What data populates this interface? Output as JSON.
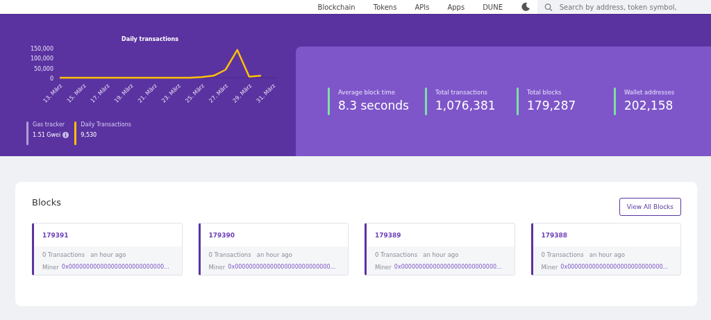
{
  "nav": {
    "items": [
      "Blockchain",
      "Tokens",
      "APIs",
      "Apps",
      "DUNE"
    ],
    "search": {
      "placeholder": "Search by address, token symbol,"
    }
  },
  "chart": {
    "chart_data": {
      "type": "line",
      "title": "Daily transactions",
      "x": [
        13,
        14,
        15,
        16,
        17,
        18,
        19,
        20,
        21,
        22,
        23,
        24,
        25,
        26,
        27,
        28,
        29,
        30
      ],
      "series": [
        {
          "color": "#ffc107",
          "values": [
            0,
            0,
            0,
            0,
            0,
            0,
            0,
            0,
            0,
            0,
            0,
            0,
            3000,
            10000,
            40000,
            140000,
            5000,
            10000
          ]
        }
      ],
      "xlim": [
        13,
        31
      ],
      "xticks": [
        {
          "value": 13,
          "label": "13. März"
        },
        {
          "value": 15,
          "label": "15. März"
        },
        {
          "value": 17,
          "label": "17. März"
        },
        {
          "value": 19,
          "label": "19. März"
        },
        {
          "value": 21,
          "label": "21. März"
        },
        {
          "value": 23,
          "label": "23. März"
        },
        {
          "value": 25,
          "label": "25. März"
        },
        {
          "value": 27,
          "label": "27. März"
        },
        {
          "value": 29,
          "label": "29. März"
        },
        {
          "value": 31,
          "label": "31. März"
        }
      ],
      "ylim": [
        0,
        150000
      ],
      "yticks": [
        {
          "value": 0,
          "label": "0"
        },
        {
          "value": 50000,
          "label": "50,000"
        },
        {
          "value": 100000,
          "label": "100,000"
        },
        {
          "value": 150000,
          "label": "150,000"
        }
      ]
    }
  },
  "mini_stats": [
    {
      "label": "Gas tracker",
      "value": "1.51 Gwei",
      "color": "#b39ddb",
      "info": true
    },
    {
      "label": "Daily Transactions",
      "value": "9,530",
      "color": "#ffc107",
      "info": false
    }
  ],
  "stats": [
    {
      "label": "Average block time",
      "value": "8.3 seconds"
    },
    {
      "label": "Total transactions",
      "value": "1,076,381"
    },
    {
      "label": "Total blocks",
      "value": "179,287"
    },
    {
      "label": "Wallet addresses",
      "value": "202,158"
    }
  ],
  "blocks": {
    "title": "Blocks",
    "button": "View All Blocks",
    "items": [
      {
        "number": "179391",
        "transactions": "0 Transactions",
        "time": "an hour ago",
        "miner_label": "Miner",
        "miner": "0x000000000000000000000000000..."
      },
      {
        "number": "179390",
        "transactions": "0 Transactions",
        "time": "an hour ago",
        "miner_label": "Miner",
        "miner": "0x000000000000000000000000000..."
      },
      {
        "number": "179389",
        "transactions": "0 Transactions",
        "time": "an hour ago",
        "miner_label": "Miner",
        "miner": "0x000000000000000000000000000..."
      },
      {
        "number": "179388",
        "transactions": "0 Transactions",
        "time": "an hour ago",
        "miner_label": "Miner",
        "miner": "0x000000000000000000000000000..."
      }
    ]
  }
}
